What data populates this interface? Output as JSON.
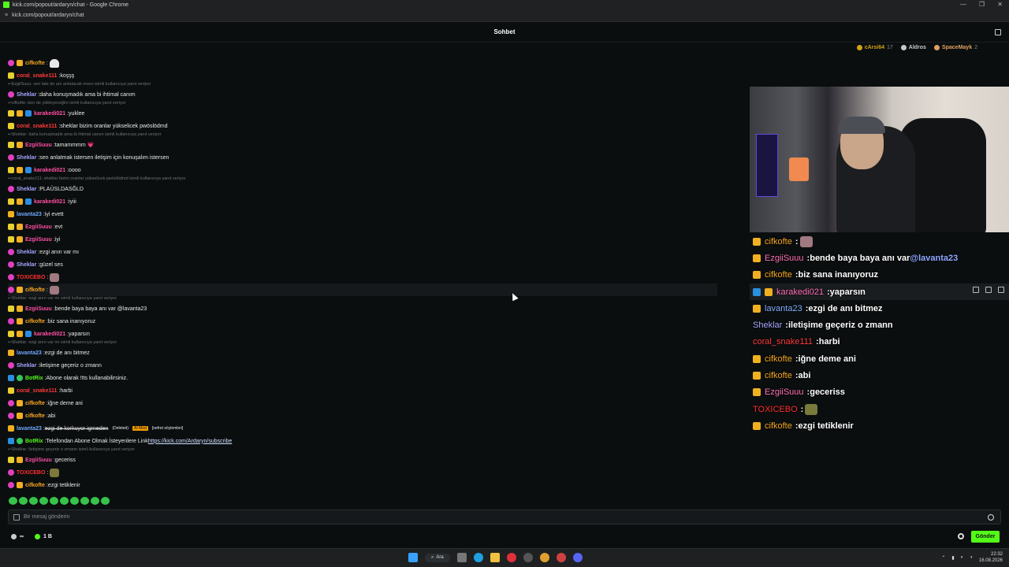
{
  "window": {
    "title": "kick.com/popout/ardaryn/chat - Google Chrome",
    "url": "kick.com/popout/ardaryn/chat",
    "controls": [
      "—",
      "❐",
      "✕"
    ]
  },
  "header": {
    "title": "Sohbet"
  },
  "leaderboard": [
    {
      "name": "cArsi64",
      "count": "17",
      "color": "#d4a017"
    },
    {
      "name": "Aldros",
      "count": "",
      "color": "#c8c8c8"
    },
    {
      "name": "SpaceMayk",
      "count": "2",
      "color": "#e0a060"
    }
  ],
  "chat": [
    {
      "kind": "msg",
      "badges": [
        "purple",
        "gold"
      ],
      "user": "cifkofte",
      "color": "#f5a623",
      "text": "",
      "emote": "w"
    },
    {
      "kind": "msg",
      "badges": [
        "yel"
      ],
      "user": "coral_snake111",
      "color": "#ff3b3b",
      "text": "koşşş"
    },
    {
      "kind": "reply",
      "text": "EzgiiSuuu: sen late de anı anlatacak mısın isimli kullanıcıya yanıt veriyor"
    },
    {
      "kind": "msg",
      "badges": [
        "purple"
      ],
      "user": "Sheklar",
      "color": "#a5a5ff",
      "text": "daha konuşmadık ama bi ihtimal canım"
    },
    {
      "kind": "reply",
      "text": "cifkofte: ben de yükleyeceğim isimli kullanıcıya yanıt veriyor"
    },
    {
      "kind": "msg",
      "badges": [
        "yel",
        "gold",
        "blue"
      ],
      "user": "karakedi021",
      "color": "#ff4fa3",
      "text": "yuklee"
    },
    {
      "kind": "msg",
      "badges": [
        "yel"
      ],
      "user": "coral_snake111",
      "color": "#ff3b3b",
      "text": "sheklar bizim oranlar yükselicek pwöslödmd"
    },
    {
      "kind": "reply",
      "text": "Sheklar: daha konuşmadık ama bi ihtimal canım isimli kullanıcıya yanıt veriyor"
    },
    {
      "kind": "msg",
      "badges": [
        "yel",
        "gold"
      ],
      "user": "EzgiiSuuu",
      "color": "#ff4fa3",
      "text": "tamammmm 💗"
    },
    {
      "kind": "msg",
      "badges": [
        "purple"
      ],
      "user": "Sheklar",
      "color": "#a5a5ff",
      "text": "sen anlatmak istersen iletişim için konuşalım istersen"
    },
    {
      "kind": "msg",
      "badges": [
        "yel",
        "gold",
        "blue"
      ],
      "user": "karakedi021",
      "color": "#ff4fa3",
      "text": "oooo"
    },
    {
      "kind": "reply",
      "text": "coral_snake111: sheklar bizim oranlar yükselicek pwöslödmd isimli kullanıcıya yanıt veriyor"
    },
    {
      "kind": "msg",
      "badges": [
        "purple"
      ],
      "user": "Sheklar",
      "color": "#a5a5ff",
      "text": "PLAÜSLDASĞLD"
    },
    {
      "kind": "msg",
      "badges": [
        "yel",
        "gold",
        "blue"
      ],
      "user": "karakedi021",
      "color": "#ff4fa3",
      "text": "iyiii"
    },
    {
      "kind": "msg",
      "badges": [
        "gold"
      ],
      "user": "lavanta23",
      "color": "#6fa8ff",
      "text": "iyi evett"
    },
    {
      "kind": "msg",
      "badges": [
        "yel",
        "gold"
      ],
      "user": "EzgiiSuuu",
      "color": "#ff4fa3",
      "text": "evt"
    },
    {
      "kind": "msg",
      "badges": [
        "yel",
        "gold"
      ],
      "user": "EzgiiSuuu",
      "color": "#ff4fa3",
      "text": "iyi"
    },
    {
      "kind": "msg",
      "badges": [
        "purple"
      ],
      "user": "Sheklar",
      "color": "#a5a5ff",
      "text": "ezgi anın var mı"
    },
    {
      "kind": "msg",
      "badges": [
        "purple"
      ],
      "user": "Sheklar",
      "color": "#a5a5ff",
      "text": "güzel ses"
    },
    {
      "kind": "msg",
      "badges": [
        "purple"
      ],
      "user": "TOXICEBO",
      "color": "#ff2d2d",
      "text": "",
      "emote": "p"
    },
    {
      "kind": "msg",
      "badges": [
        "purple",
        "gold"
      ],
      "user": "cifkofte",
      "color": "#f5a623",
      "text": "",
      "emote": "p",
      "hl": true
    },
    {
      "kind": "reply",
      "text": "Sheklar: ezgi anın var mı isimli kullanıcıya yanıt veriyor"
    },
    {
      "kind": "msg",
      "badges": [
        "yel",
        "gold"
      ],
      "user": "EzgiiSuuu",
      "color": "#ff4fa3",
      "text": "bende baya baya anı var @lavanta23"
    },
    {
      "kind": "msg",
      "badges": [
        "purple",
        "gold"
      ],
      "user": "cifkofte",
      "color": "#f5a623",
      "text": "biz sana inanıyoruz"
    },
    {
      "kind": "msg",
      "badges": [
        "yel",
        "gold",
        "blue"
      ],
      "user": "karakedi021",
      "color": "#ff4fa3",
      "text": "yaparsın"
    },
    {
      "kind": "reply",
      "text": "Sheklar: ezgi anın var mı isimli kullanıcıya yanıt veriyor"
    },
    {
      "kind": "msg",
      "badges": [
        "gold"
      ],
      "user": "lavanta23",
      "color": "#6fa8ff",
      "text": "ezgi de anı bitmez"
    },
    {
      "kind": "msg",
      "badges": [
        "purple"
      ],
      "user": "Sheklar",
      "color": "#a5a5ff",
      "text": "iletişime geçeriz o zmann"
    },
    {
      "kind": "msg",
      "badges": [
        "blue",
        "green"
      ],
      "user": "BotRix",
      "color": "#53fc18",
      "text": "Abone olarak !tts kullanabilirsiniz."
    },
    {
      "kind": "msg",
      "badges": [
        "yel"
      ],
      "user": "coral_snake111",
      "color": "#ff3b3b",
      "text": "harbi"
    },
    {
      "kind": "msg",
      "badges": [
        "purple",
        "gold"
      ],
      "user": "cifkofte",
      "color": "#f5a623",
      "text": "iğne deme ani"
    },
    {
      "kind": "msg",
      "badges": [
        "purple",
        "gold"
      ],
      "user": "cifkofte",
      "color": "#f5a623",
      "text": "abi"
    },
    {
      "kind": "msg",
      "badges": [
        "gold"
      ],
      "user": "lavanta23",
      "color": "#6fa8ff",
      "deleted": "ezgi de korkuyor igrneden",
      "deleted_tag": "(Deleted)",
      "mod_tag": "AI Mod",
      "reason_tag": "[nefret söylemleri]"
    },
    {
      "kind": "msg",
      "badges": [
        "blue",
        "green"
      ],
      "user": "BotRix",
      "color": "#53fc18",
      "text": "Telefondan Abone Olmak İsteyenlere Link ",
      "link": "https://kick.com/Ardaryn/subscribe"
    },
    {
      "kind": "reply",
      "text": "Sheklar: iletişime geçeriz o zmann isimli kullanıcıya yanıt veriyor"
    },
    {
      "kind": "msg",
      "badges": [
        "yel",
        "gold"
      ],
      "user": "EzgiiSuuu",
      "color": "#ff4fa3",
      "text": "geceriss"
    },
    {
      "kind": "msg",
      "badges": [
        "purple"
      ],
      "user": "TOXICEBO",
      "color": "#ff2d2d",
      "text": "",
      "emote": "g"
    },
    {
      "kind": "msg",
      "badges": [
        "purple",
        "gold"
      ],
      "user": "cifkofte",
      "color": "#f5a623",
      "text": "ezgi tetiklenir"
    }
  ],
  "input": {
    "placeholder": "Bir mesaj gönderin",
    "send_label": "Gönder"
  },
  "status": {
    "connections": "∞",
    "viewers": "1 B"
  },
  "overlay": [
    {
      "badges": [
        "gold"
      ],
      "user": "cifkofte",
      "color": "#f5a623",
      "text": "",
      "emote": "p"
    },
    {
      "badges": [
        "gold"
      ],
      "user": "EzgiiSuuu",
      "color": "#ff6fb5",
      "text": "bende baya baya anı var",
      "mention": "@lavanta23"
    },
    {
      "badges": [
        "gold"
      ],
      "user": "cifkofte",
      "color": "#f5a623",
      "text": "biz sana inanıyoruz"
    },
    {
      "badges": [
        "blue",
        "gold"
      ],
      "user": "karakedi021",
      "color": "#ff6fb5",
      "text": "yaparsın",
      "hl": true
    },
    {
      "badges": [
        "gold"
      ],
      "user": "lavanta23",
      "color": "#7fb0ff",
      "text": "ezgi de anı bitmez"
    },
    {
      "badges": [],
      "user": "Sheklar",
      "color": "#a5a5ff",
      "text": "iletişime geçeriz o zmann"
    },
    {
      "badges": [],
      "user": "coral_snake111",
      "color": "#ff3b3b",
      "text": "harbi"
    },
    {
      "badges": [
        "gold"
      ],
      "user": "cifkofte",
      "color": "#f5a623",
      "text": "iğne deme ani"
    },
    {
      "badges": [
        "gold"
      ],
      "user": "cifkofte",
      "color": "#f5a623",
      "text": "abi"
    },
    {
      "badges": [
        "gold"
      ],
      "user": "EzgiiSuuu",
      "color": "#ff6fb5",
      "text": "geceriss"
    },
    {
      "badges": [],
      "user": "TOXICEBO",
      "color": "#ff2d2d",
      "text": "",
      "emote": "g"
    },
    {
      "badges": [
        "gold"
      ],
      "user": "cifkofte",
      "color": "#f5a623",
      "text": "ezgi tetiklenir"
    }
  ],
  "taskbar": {
    "search_label": "Ara",
    "time": "22:32",
    "date": "16.08.2026"
  }
}
